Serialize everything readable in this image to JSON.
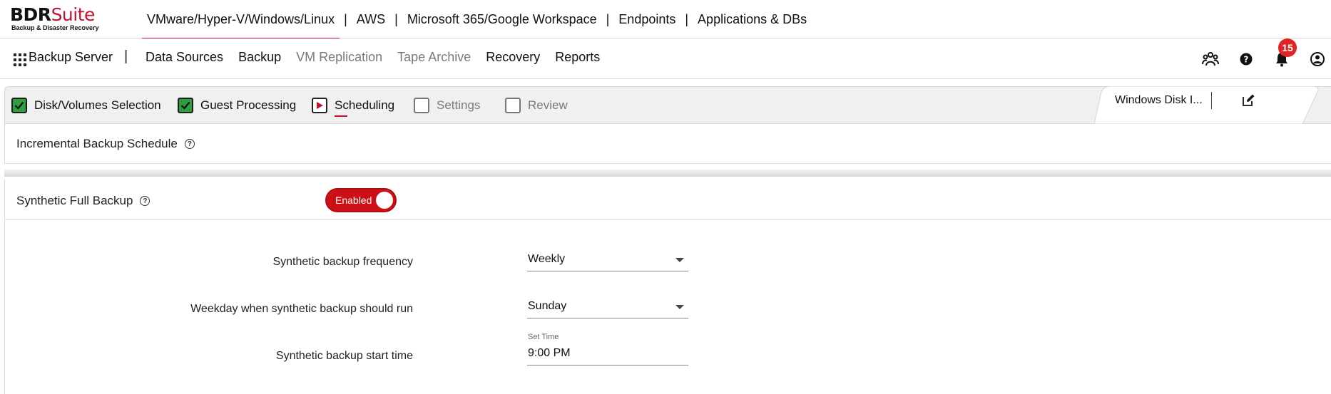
{
  "logo": {
    "brand_bdr": "BDR",
    "brand_suite": "Suite",
    "tagline": "Backup & Disaster Recovery"
  },
  "products": [
    {
      "label": "VMware/Hyper-V/Windows/Linux",
      "active": true
    },
    {
      "label": "AWS",
      "active": false
    },
    {
      "label": "Microsoft 365/Google Workspace",
      "active": false
    },
    {
      "label": "Endpoints",
      "active": false
    },
    {
      "label": "Applications & DBs",
      "active": false
    }
  ],
  "product_separator": "|",
  "nav": {
    "title": "Backup Server",
    "separator": "|",
    "links": [
      {
        "label": "Data Sources",
        "dim": false
      },
      {
        "label": "Backup",
        "dim": false
      },
      {
        "label": "VM Replication",
        "dim": true
      },
      {
        "label": "Tape Archive",
        "dim": true
      },
      {
        "label": "Recovery",
        "dim": false
      },
      {
        "label": "Reports",
        "dim": false
      }
    ],
    "icons": [
      "users-icon",
      "help-icon",
      "bell-icon",
      "account-icon"
    ],
    "notification_count": "15"
  },
  "steps": [
    {
      "label": "Disk/Volumes Selection",
      "state": "done"
    },
    {
      "label": "Guest Processing",
      "state": "done"
    },
    {
      "label": "Scheduling",
      "state": "current"
    },
    {
      "label": "Settings",
      "state": "todo"
    },
    {
      "label": "Review",
      "state": "todo"
    }
  ],
  "job": {
    "name": "Windows Disk I..."
  },
  "incremental": {
    "title": "Incremental Backup Schedule",
    "help": "?"
  },
  "synthetic": {
    "title": "Synthetic Full Backup",
    "help": "?",
    "toggle_label": "Enabled",
    "frequency_label": "Synthetic backup frequency",
    "frequency_value": "Weekly",
    "weekday_label": "Weekday when synthetic backup should run",
    "weekday_value": "Sunday",
    "start_label": "Synthetic backup start time",
    "start_caption": "Set Time",
    "start_value": "9:00 PM"
  },
  "colors": {
    "accent": "#c8102e",
    "check_green": "#2e9e3f",
    "badge_red": "#e02424"
  }
}
